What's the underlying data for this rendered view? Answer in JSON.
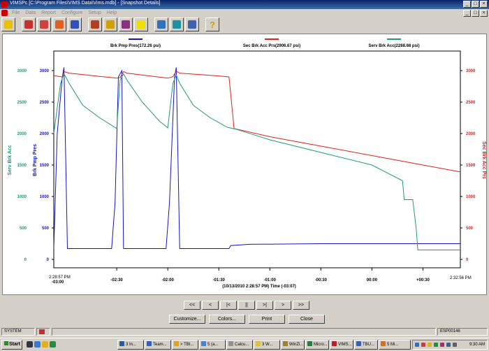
{
  "window": {
    "title": "VIMSPc [C:\\Program Files\\VIMS Data\\Vims.mdb] - [Snapshot Details]"
  },
  "menu": [
    "File",
    "Data",
    "Report",
    "Configure",
    "Setup",
    "Help"
  ],
  "toolbar": {
    "tools": [
      "tool-1",
      "tool-2",
      "tool-3",
      "tool-4",
      "tool-5",
      "tool-6",
      "tool-7",
      "tool-8",
      "tool-9",
      "tool-10",
      "tool-11",
      "help-tool"
    ]
  },
  "chart_data": {
    "type": "line",
    "xlabel": "(10/13/2010 2:28:57 PM) Time (-03:07)",
    "start_label": [
      "2:28:57 PM",
      "-03:00"
    ],
    "end_label": "2:32:56 PM",
    "x_ticks": [
      "-02:30",
      "-02:00",
      "-01:30",
      "-01:00",
      "-00:30",
      "00:00",
      "+00:30"
    ],
    "x_tick_seconds": [
      -150,
      -120,
      -90,
      -60,
      -30,
      0,
      30
    ],
    "xlim": [
      -187,
      52
    ],
    "legend": [
      {
        "label": "Brk Pmp Pres(172.26 psi)",
        "color": "#1414c8"
      },
      {
        "label": "Sec Brk Acc Prs(2906.67 psi)",
        "color": "#e0201c"
      },
      {
        "label": "Serv Brk Acc(2288.68 psi)",
        "color": "#1e9a78"
      }
    ],
    "left_axes": [
      {
        "label": "Serv Brk Acc",
        "color": "#1e9a78",
        "ticks": [
          "3000",
          "2500",
          "2000",
          "1500",
          "1000",
          "500",
          "0"
        ]
      },
      {
        "label": "Brk Pmp Pres",
        "color": "#1414c8",
        "ticks": [
          "3000",
          "2500",
          "2000",
          "1500",
          "1000",
          "500",
          "0"
        ]
      }
    ],
    "right_axis": {
      "label": "Sec Brk Acc Prs",
      "color": "#e0201c",
      "ticks": [
        "3000",
        "2500",
        "2000",
        "1500",
        "1000",
        "500",
        "0"
      ]
    },
    "ylim": [
      0,
      3000
    ],
    "series": [
      {
        "name": "Brk Pmp Pres",
        "color": "#1414c8",
        "x": [
          -187,
          -185,
          -182,
          -181,
          -179,
          -177,
          -153,
          -151,
          -149,
          -147,
          -146,
          -143,
          -121,
          -119,
          -116,
          -115,
          -113,
          -84,
          -83,
          -72,
          -30,
          0,
          30,
          45,
          52
        ],
        "y": [
          172,
          2000,
          2900,
          3050,
          172,
          172,
          172,
          900,
          2900,
          3000,
          172,
          172,
          172,
          900,
          2900,
          3050,
          172,
          172,
          220,
          240,
          250,
          250,
          250,
          250,
          250
        ]
      },
      {
        "name": "Sec Brk Acc Prs",
        "color": "#e0201c",
        "x": [
          -187,
          -182,
          -181,
          -178,
          -150,
          -148,
          -146,
          -144,
          -120,
          -117,
          -115,
          -113,
          -92,
          -84,
          -81,
          -60,
          -30,
          0,
          30,
          52
        ],
        "y": [
          2920,
          2900,
          2985,
          2960,
          2880,
          2890,
          2985,
          2960,
          2880,
          2905,
          2990,
          2960,
          2920,
          2900,
          2080,
          1950,
          1800,
          1650,
          1500,
          1390
        ]
      },
      {
        "name": "Serv Brk Acc",
        "color": "#1e9a78",
        "x": [
          -187,
          -183,
          -181,
          -178,
          -170,
          -160,
          -150,
          -148,
          -146,
          -144,
          -135,
          -125,
          -120,
          -117,
          -115,
          -113,
          -105,
          -95,
          -85,
          -80,
          -60,
          -30,
          0,
          18,
          19,
          24,
          26,
          27,
          40,
          52
        ],
        "y": [
          2000,
          2800,
          2950,
          2800,
          2450,
          2250,
          2080,
          2850,
          2950,
          2850,
          2500,
          2200,
          2090,
          2800,
          2930,
          2800,
          2450,
          2250,
          2100,
          2070,
          1900,
          1700,
          1500,
          1250,
          950,
          950,
          500,
          150,
          150,
          150
        ]
      }
    ]
  },
  "nav": {
    "buttons": [
      "<<",
      "<",
      "|<",
      "||",
      ">|",
      ">",
      ">>"
    ]
  },
  "actions": {
    "customize": "Customize...",
    "colors": "Colors...",
    "print": "Print",
    "close": "Close"
  },
  "status": {
    "left": "SYSTEM",
    "right": "ESP00146"
  },
  "taskbar": {
    "start": "Start",
    "tasks": [
      "3 In...",
      "Team...",
      "> TBI...",
      "5 (a...",
      "Calcu...",
      "3 W...",
      "WinZi...",
      "Micro...",
      "VIMS...",
      "TBU...",
      "5 Mi..."
    ],
    "clock": "9:30 AM"
  },
  "colors": {
    "accent": "#0a246a",
    "bg": "#d4d0c8"
  }
}
